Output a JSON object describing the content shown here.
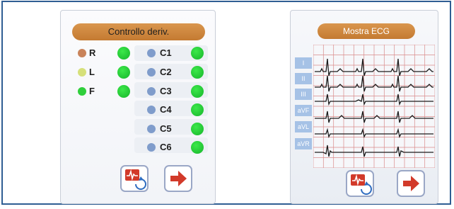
{
  "left_screen": {
    "title": "Controllo deriv.",
    "limb_leads": [
      {
        "label": "R",
        "color": "#c9835a"
      },
      {
        "label": "L",
        "color": "#d6e07a"
      },
      {
        "label": "F",
        "color": "#2fcf3b"
      }
    ],
    "chest_leads": [
      "C1",
      "C2",
      "C3",
      "C4",
      "C5",
      "C6"
    ],
    "chest_dot_color": "#7f9ccb",
    "status_color": "#22c533"
  },
  "right_screen": {
    "title": "Mostra ECG",
    "lead_tabs": [
      "I",
      "II",
      "III",
      "aVF",
      "aVL",
      "aVR"
    ]
  },
  "icons": {
    "ecg_refresh": "ecg-refresh-icon",
    "next_arrow": "right-arrow-icon"
  }
}
